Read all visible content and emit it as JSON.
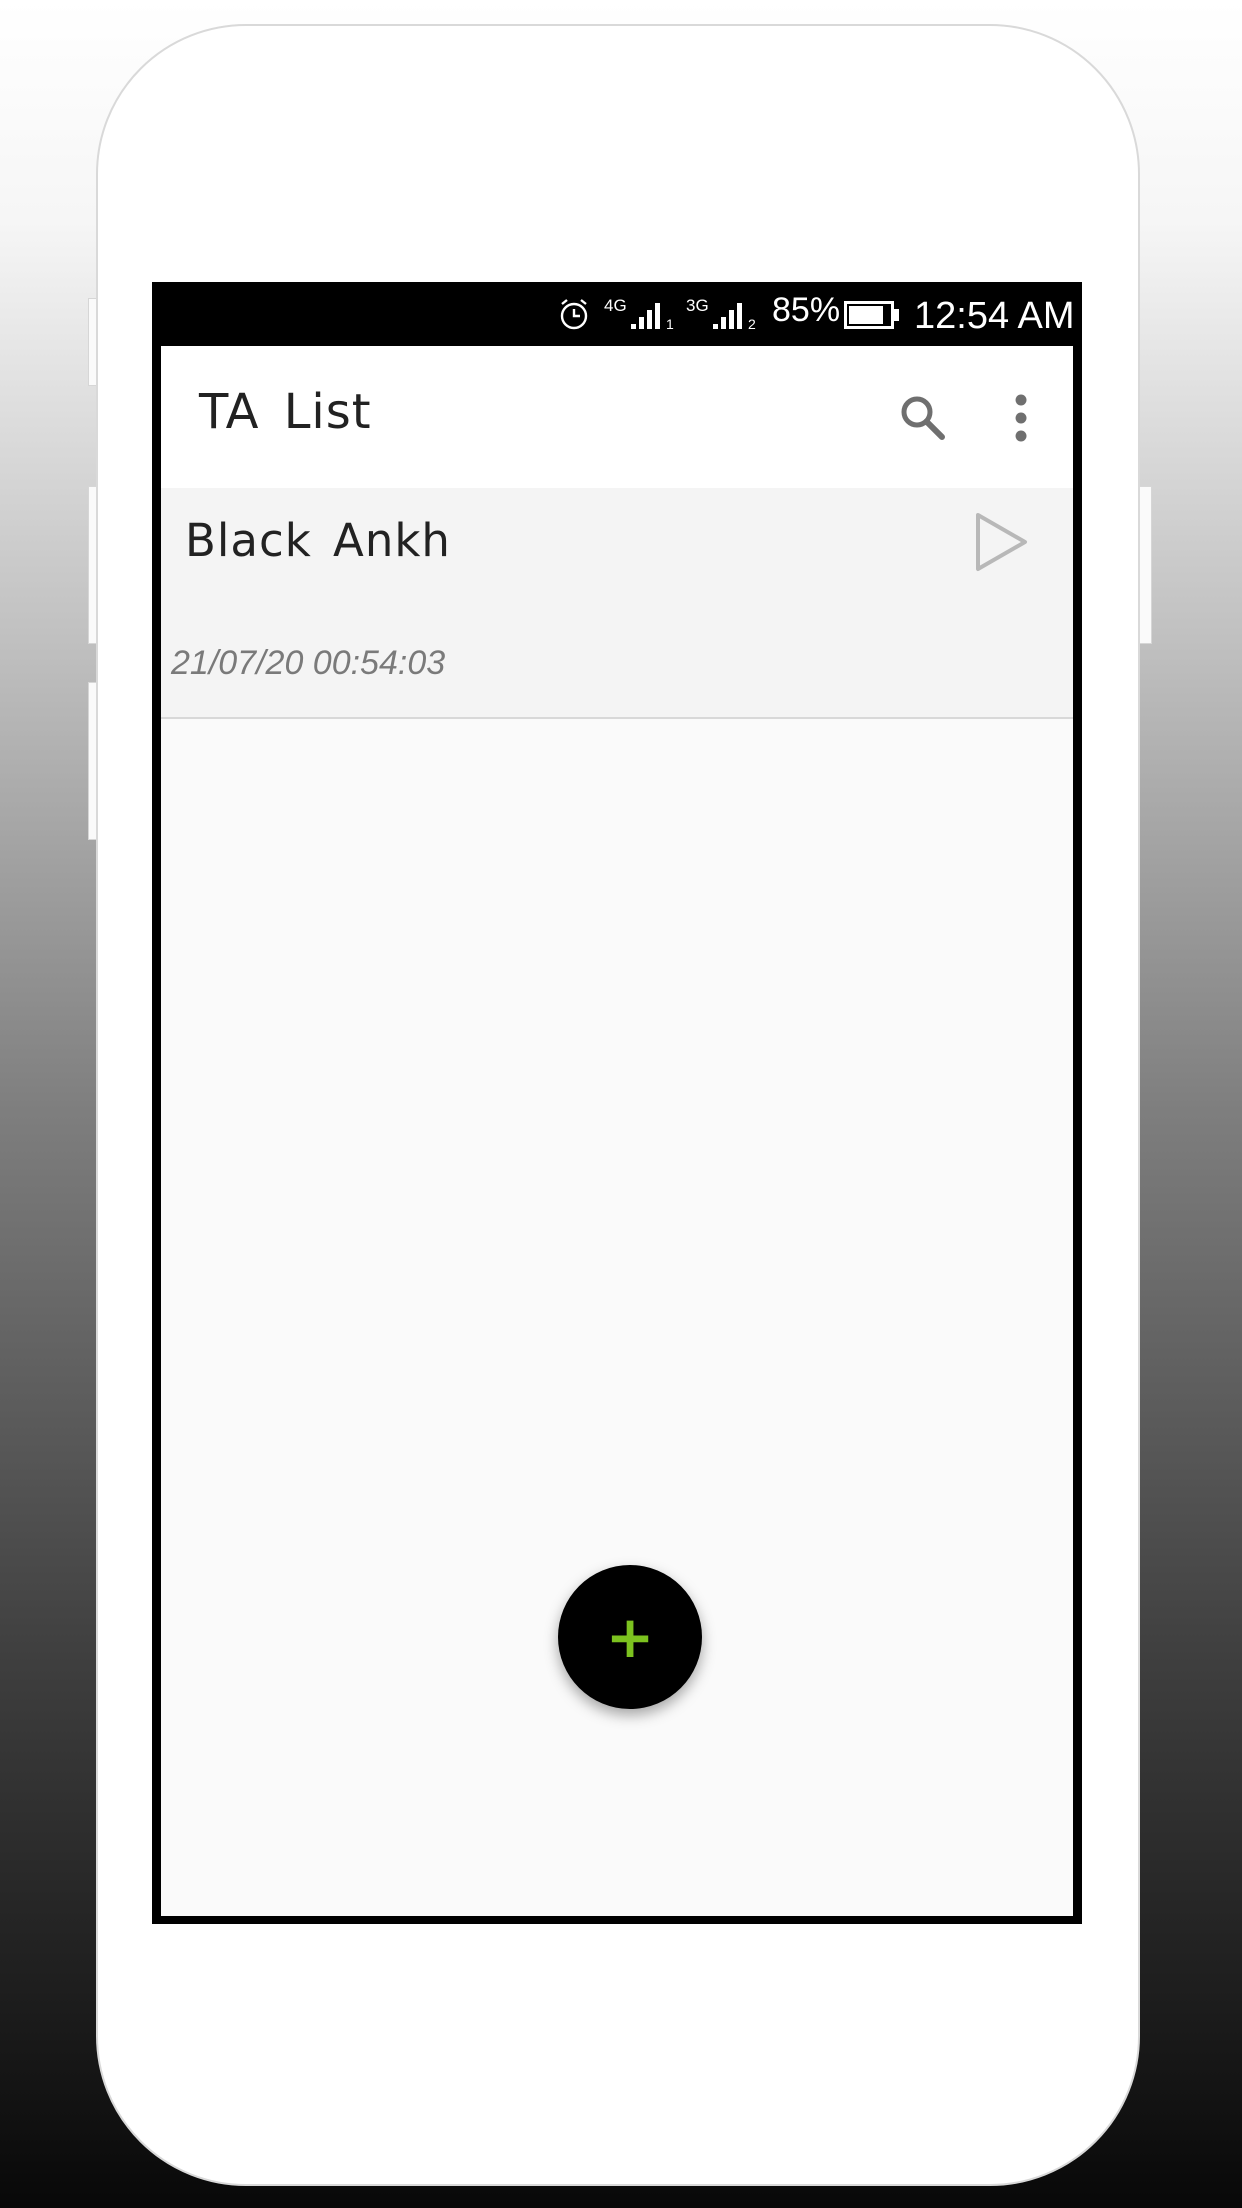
{
  "status_bar": {
    "alarm_icon": "alarm-clock-icon",
    "sim1_network": "4G",
    "sim1_slot": "1",
    "sim2_network": "3G",
    "sim2_slot": "2",
    "battery_percent": "85%",
    "battery_level": 0.85,
    "time": "12:54 AM"
  },
  "toolbar": {
    "title": "TA  List",
    "search_icon": "search-icon",
    "more_icon": "more-vert-icon"
  },
  "list": {
    "items": [
      {
        "name": "Black  Ankh",
        "timestamp": "21/07/20 00:54:03",
        "action_icon": "play-icon"
      }
    ]
  },
  "fab": {
    "label": "+",
    "icon": "add-icon",
    "icon_color": "#7cc21f"
  },
  "colors": {
    "screen_background": "#fafafa",
    "toolbar_background": "#ffffff",
    "fab_background": "#000000",
    "accent": "#7cc21f"
  }
}
